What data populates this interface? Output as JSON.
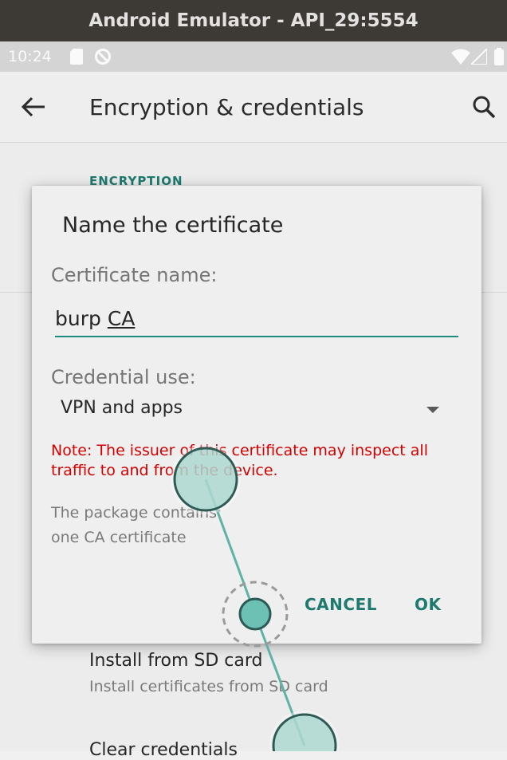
{
  "window": {
    "title": "Android Emulator - API_29:5554"
  },
  "status_bar": {
    "time": "10:24",
    "icons": [
      "sd-card-icon",
      "no-sync-icon",
      "wifi-icon",
      "signal-icon",
      "battery-icon"
    ]
  },
  "app_bar": {
    "title": "Encryption & credentials",
    "back_icon": "back-arrow-icon",
    "search_icon": "search-icon"
  },
  "settings": {
    "section_header": "ENCRYPTION",
    "items": [
      {
        "title": "Install from SD card",
        "subtitle": "Install certificates from SD card"
      },
      {
        "title": "Clear credentials"
      }
    ]
  },
  "dialog": {
    "title": "Name the certificate",
    "name_label": "Certificate name:",
    "name_value_plain": "burp ",
    "name_value_underlined": "CA",
    "use_label": "Credential use:",
    "use_value": "VPN and apps",
    "note": "Note: The issuer of this certificate may inspect all traffic to and from the device.",
    "package_line1": "The package contains:",
    "package_line2": "one CA certificate",
    "cancel_label": "CANCEL",
    "ok_label": "OK"
  },
  "colors": {
    "accent": "#1e7a6e",
    "warning": "#d50000",
    "touch_indicator": "#6cc0b4"
  }
}
